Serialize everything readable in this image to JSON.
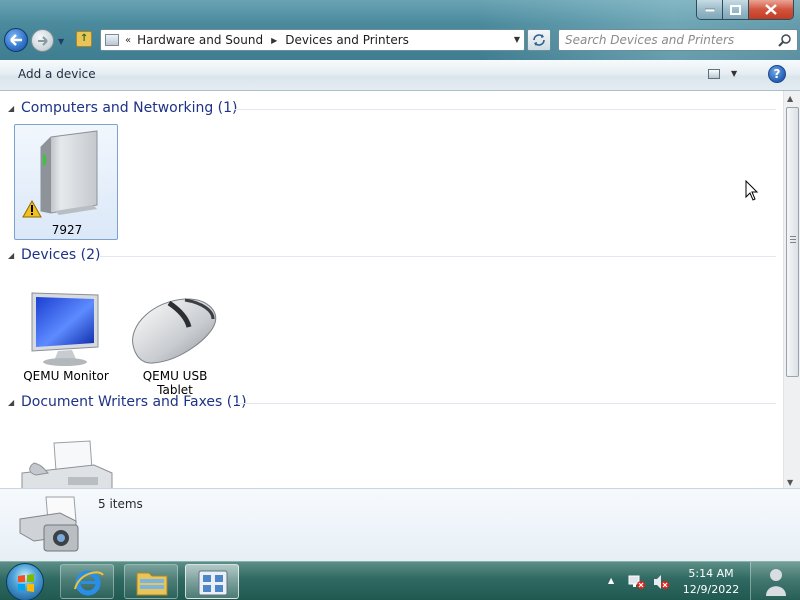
{
  "window": {
    "caption_buttons": [
      "minimize",
      "maximize",
      "close"
    ]
  },
  "address_bar": {
    "chevron": "«",
    "crumbs": [
      "Hardware and Sound",
      "Devices and Printers"
    ]
  },
  "search": {
    "placeholder": "Search Devices and Printers"
  },
  "command_bar": {
    "add_device": "Add a device",
    "help_label": "?"
  },
  "groups": [
    {
      "title": "Computers and Networking (1)",
      "devices": [
        {
          "name": "7927",
          "icon": "computer-tower-icon",
          "warning": true
        }
      ]
    },
    {
      "title": "Devices (2)",
      "devices": [
        {
          "name": "QEMU Monitor",
          "icon": "monitor-icon"
        },
        {
          "name": "QEMU USB Tablet",
          "icon": "mouse-icon"
        }
      ]
    },
    {
      "title": "Document Writers and Faxes (1)",
      "devices": [
        {
          "name": "",
          "icon": "fax-icon"
        }
      ]
    }
  ],
  "details": {
    "count": "5 items",
    "icon": "devices-printers-icon"
  },
  "taskbar": {
    "pinned": [
      "start-orb",
      "internet-explorer-icon",
      "windows-explorer-icon",
      "devices-and-printers-icon"
    ],
    "active": "devices-and-printers-icon",
    "clock_time": "5:14 AM",
    "clock_date": "12/9/2022"
  },
  "colors": {
    "group_title": "#1e3287",
    "taskbar": "#2f6961",
    "selection": "#dbe8f8"
  }
}
